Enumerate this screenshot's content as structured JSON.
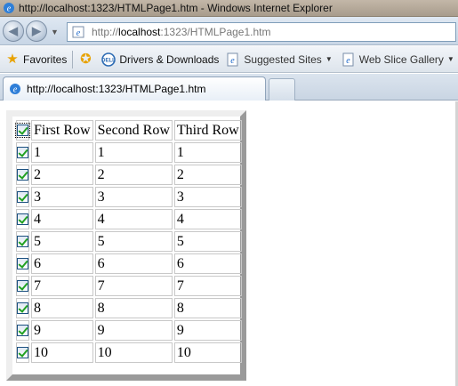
{
  "window": {
    "title": "http://localhost:1323/HTMLPage1.htm - Windows Internet Explorer"
  },
  "address_bar": {
    "url_prefix": "http://",
    "url_host": "localhost",
    "url_rest": ":1323/HTMLPage1.htm"
  },
  "favorites_bar": {
    "favorites_label": "Favorites",
    "items": [
      {
        "label": "Drivers & Downloads",
        "icon": "dell-icon"
      },
      {
        "label": "Suggested Sites",
        "icon": "ie-page-icon"
      },
      {
        "label": "Web Slice Gallery",
        "icon": "ie-page-icon"
      }
    ]
  },
  "tabs": [
    {
      "label": "http://localhost:1323/HTMLPage1.htm"
    }
  ],
  "table": {
    "headers": [
      "First Row",
      "Second Row",
      "Third Row"
    ],
    "header_checked": true,
    "rows": [
      {
        "checked": true,
        "cells": [
          "1",
          "1",
          "1"
        ]
      },
      {
        "checked": true,
        "cells": [
          "2",
          "2",
          "2"
        ]
      },
      {
        "checked": true,
        "cells": [
          "3",
          "3",
          "3"
        ]
      },
      {
        "checked": true,
        "cells": [
          "4",
          "4",
          "4"
        ]
      },
      {
        "checked": true,
        "cells": [
          "5",
          "5",
          "5"
        ]
      },
      {
        "checked": true,
        "cells": [
          "6",
          "6",
          "6"
        ]
      },
      {
        "checked": true,
        "cells": [
          "7",
          "7",
          "7"
        ]
      },
      {
        "checked": true,
        "cells": [
          "8",
          "8",
          "8"
        ]
      },
      {
        "checked": true,
        "cells": [
          "9",
          "9",
          "9"
        ]
      },
      {
        "checked": true,
        "cells": [
          "10",
          "10",
          "10"
        ]
      }
    ]
  }
}
